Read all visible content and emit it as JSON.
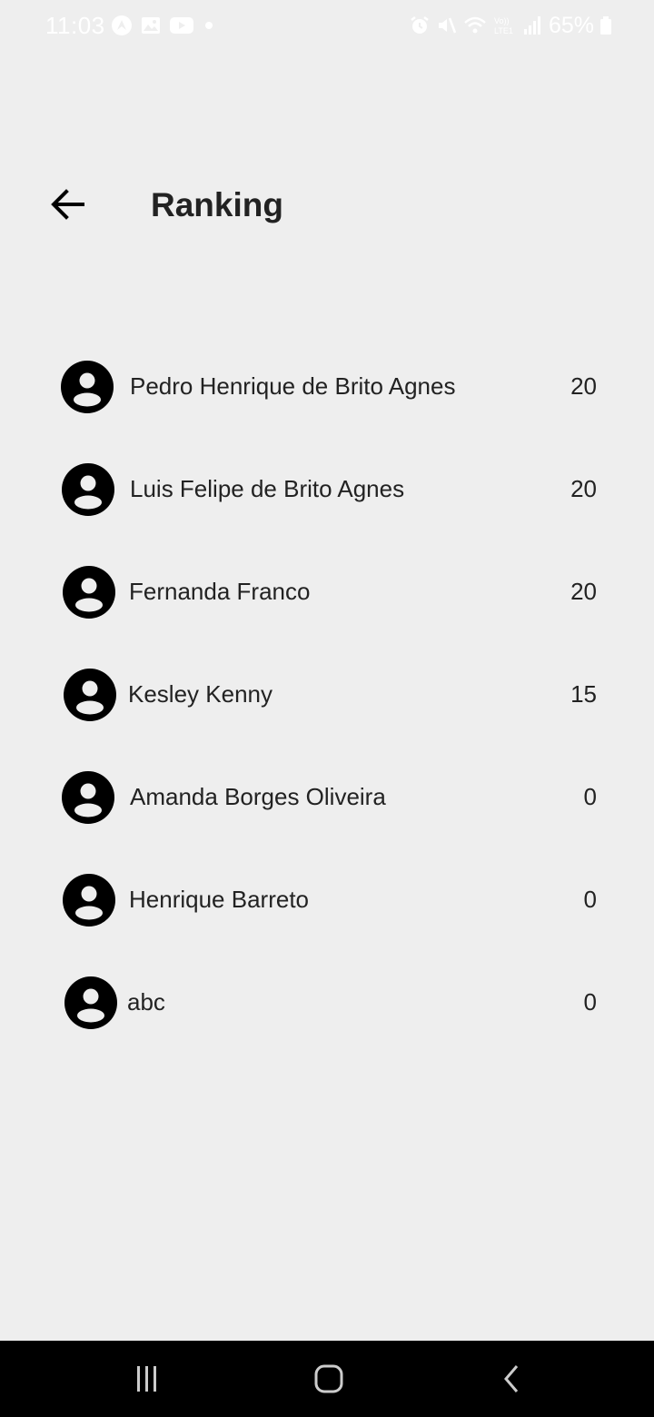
{
  "status_bar": {
    "time": "11:03",
    "battery": "65%",
    "left_icons": [
      "navigation-app-icon",
      "gallery-icon",
      "youtube-icon",
      "notification-dot"
    ],
    "right_icons": [
      "alarm-icon",
      "mute-icon",
      "wifi-icon",
      "volte-lte-icon",
      "signal-icon",
      "battery-icon"
    ]
  },
  "header": {
    "back_icon": "arrow-left-icon",
    "title": "Ranking"
  },
  "ranking": [
    {
      "name": "Pedro Henrique de Brito Agnes",
      "score": "20"
    },
    {
      "name": "Luis Felipe de Brito Agnes",
      "score": "20"
    },
    {
      "name": "Fernanda Franco",
      "score": "20"
    },
    {
      "name": "Kesley Kenny",
      "score": "15"
    },
    {
      "name": "Amanda Borges Oliveira",
      "score": "0"
    },
    {
      "name": "Henrique Barreto",
      "score": "0"
    },
    {
      "name": "abc",
      "score": "0"
    }
  ],
  "nav_bar": {
    "recents_icon": "recent-apps-icon",
    "home_icon": "home-icon",
    "back_icon": "back-chevron-icon"
  },
  "colors": {
    "background": "#eeeeee",
    "text": "#222222",
    "nav_bar": "#000000",
    "status_text": "#ffffff"
  }
}
